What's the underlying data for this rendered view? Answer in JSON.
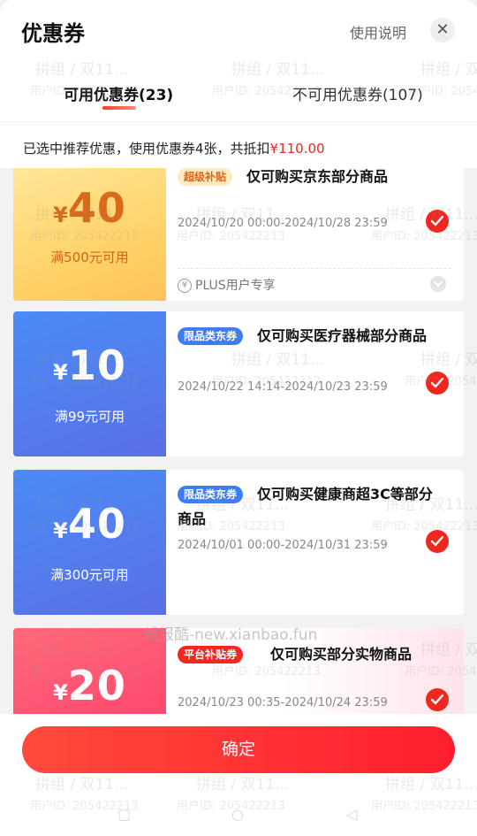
{
  "header": {
    "title": "优惠券",
    "help_label": "使用说明",
    "close_label": "✕"
  },
  "tabs": [
    {
      "label": "可用优惠券(23)",
      "active": true
    },
    {
      "label": "不可用优惠券(107)",
      "active": false
    }
  ],
  "summary": {
    "text": "已选中推荐优惠，使用优惠券4张，共抵扣",
    "amount": "¥110.00"
  },
  "coupons": [
    {
      "currency": "¥",
      "amount": "40",
      "condition": "满500元可用",
      "badge": "超级补贴",
      "name": "仅可购买京东部分商品",
      "validity": "2024/10/20 00:00-2024/10/28 23:59",
      "extra": "PLUS用户专享",
      "selected": true
    },
    {
      "currency": "¥",
      "amount": "10",
      "condition": "满99元可用",
      "badge": "限品类东券",
      "name": "仅可购买医疗器械部分商品",
      "validity": "2024/10/22 14:14-2024/10/23 23:59",
      "selected": true
    },
    {
      "currency": "¥",
      "amount": "40",
      "condition": "满300元可用",
      "badge": "限品类东券",
      "name": "仅可购买健康商超3C等部分商品",
      "validity": "2024/10/01 00:00-2024/10/31 23:59",
      "selected": true
    },
    {
      "currency": "¥",
      "amount": "20",
      "badge": "平台补贴券",
      "name": "仅可购买部分实物商品",
      "validity": "2024/10/23 00:35-2024/10/24 23:59",
      "selected": true
    }
  ],
  "footer": {
    "confirm_label": "确定"
  },
  "watermark": {
    "group_text": "拼组 / 双11...",
    "user_id": "用户ID: 205422213",
    "site": "线报酷-new.xianbao.fun"
  },
  "colors": {
    "accent": "#f0261f",
    "gold_stub": "#ffd36a",
    "blue_stub": "#4a8cf6",
    "red_stub": "#ff3a6a"
  }
}
